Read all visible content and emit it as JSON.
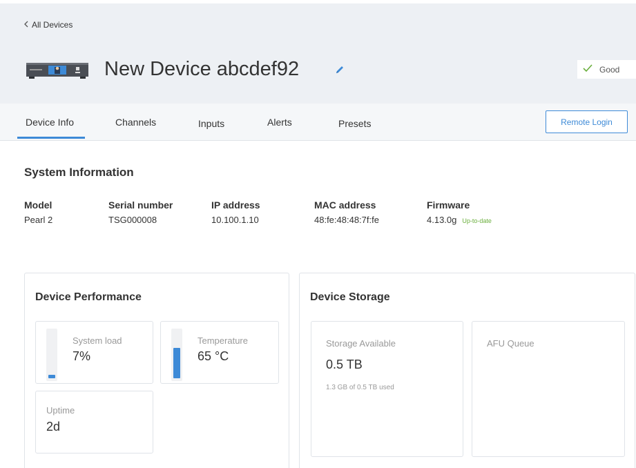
{
  "header": {
    "back_label": "All Devices",
    "device_name": "New Device abcdef92",
    "status": "Good"
  },
  "tabs": [
    {
      "label": "Device Info",
      "active": true
    },
    {
      "label": "Channels",
      "active": false
    },
    {
      "label": "Inputs",
      "active": false
    },
    {
      "label": "Alerts",
      "active": false
    },
    {
      "label": "Presets",
      "active": false
    }
  ],
  "remote_login_label": "Remote Login",
  "system_info": {
    "title": "System Information",
    "fields": [
      {
        "label": "Model",
        "value": "Pearl 2"
      },
      {
        "label": "Serial number",
        "value": "TSG000008"
      },
      {
        "label": "IP address",
        "value": "10.100.1.10"
      },
      {
        "label": "MAC address",
        "value": "48:fe:48:48:7f:fe"
      },
      {
        "label": "Firmware",
        "value": "4.13.0g",
        "badge": "Up-to-date"
      }
    ]
  },
  "performance": {
    "title": "Device Performance",
    "system_load": {
      "label": "System load",
      "value": "7%",
      "fill_fraction": 0.07
    },
    "temperature": {
      "label": "Temperature",
      "value": "65 °C",
      "fill_fraction": 0.65
    },
    "uptime": {
      "label": "Uptime",
      "value": "2d"
    }
  },
  "storage": {
    "title": "Device Storage",
    "available": {
      "label": "Storage Available",
      "value": "0.5 TB",
      "note": "1.3 GB of 0.5 TB used"
    },
    "afu_queue": {
      "label": "AFU Queue"
    }
  },
  "colors": {
    "accent": "#3d8ad7",
    "good": "#6aae3c"
  }
}
